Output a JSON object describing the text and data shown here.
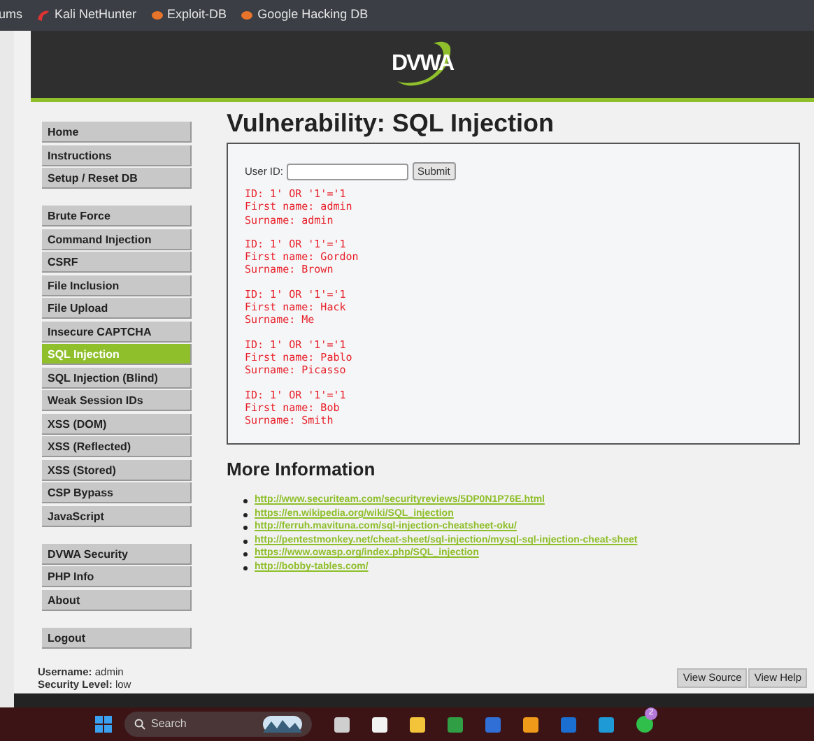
{
  "bookmarks": [
    {
      "label": "ums",
      "kind": "plain"
    },
    {
      "label": "Kali NetHunter",
      "kind": "kali"
    },
    {
      "label": "Exploit-DB",
      "kind": "exploit"
    },
    {
      "label": "Google Hacking DB",
      "kind": "exploit"
    }
  ],
  "logo": "DVWA",
  "menu_groups": [
    [
      {
        "label": "Home",
        "selected": false
      },
      {
        "label": "Instructions",
        "selected": false
      },
      {
        "label": "Setup / Reset DB",
        "selected": false
      }
    ],
    [
      {
        "label": "Brute Force",
        "selected": false
      },
      {
        "label": "Command Injection",
        "selected": false
      },
      {
        "label": "CSRF",
        "selected": false
      },
      {
        "label": "File Inclusion",
        "selected": false
      },
      {
        "label": "File Upload",
        "selected": false
      },
      {
        "label": "Insecure CAPTCHA",
        "selected": false
      },
      {
        "label": "SQL Injection",
        "selected": true
      },
      {
        "label": "SQL Injection (Blind)",
        "selected": false
      },
      {
        "label": "Weak Session IDs",
        "selected": false
      },
      {
        "label": "XSS (DOM)",
        "selected": false
      },
      {
        "label": "XSS (Reflected)",
        "selected": false
      },
      {
        "label": "XSS (Stored)",
        "selected": false
      },
      {
        "label": "CSP Bypass",
        "selected": false
      },
      {
        "label": "JavaScript",
        "selected": false
      }
    ],
    [
      {
        "label": "DVWA Security",
        "selected": false
      },
      {
        "label": "PHP Info",
        "selected": false
      },
      {
        "label": "About",
        "selected": false
      }
    ],
    [
      {
        "label": "Logout",
        "selected": false
      }
    ]
  ],
  "title": "Vulnerability: SQL Injection",
  "form": {
    "label": "User ID:",
    "button": "Submit"
  },
  "results": [
    [
      "ID: 1' OR '1'='1",
      "First name: admin",
      "Surname: admin"
    ],
    [
      "ID: 1' OR '1'='1",
      "First name: Gordon",
      "Surname: Brown"
    ],
    [
      "ID: 1' OR '1'='1",
      "First name: Hack",
      "Surname: Me"
    ],
    [
      "ID: 1' OR '1'='1",
      "First name: Pablo",
      "Surname: Picasso"
    ],
    [
      "ID: 1' OR '1'='1",
      "First name: Bob",
      "Surname: Smith"
    ]
  ],
  "more_info": {
    "heading": "More Information",
    "links": [
      "http://www.securiteam.com/securityreviews/5DP0N1P76E.html",
      "https://en.wikipedia.org/wiki/SQL_injection",
      "http://ferruh.mavituna.com/sql-injection-cheatsheet-oku/",
      "http://pentestmonkey.net/cheat-sheet/sql-injection/mysql-sql-injection-cheat-sheet",
      "https://www.owasp.org/index.php/SQL_injection",
      "http://bobby-tables.com/"
    ]
  },
  "footer": {
    "username_label": "Username:",
    "username": "admin",
    "security_label": "Security Level:",
    "security": "low",
    "buttons": [
      "View Source",
      "View Help"
    ]
  },
  "taskbar": {
    "search_placeholder": "Search",
    "badge": "2"
  }
}
